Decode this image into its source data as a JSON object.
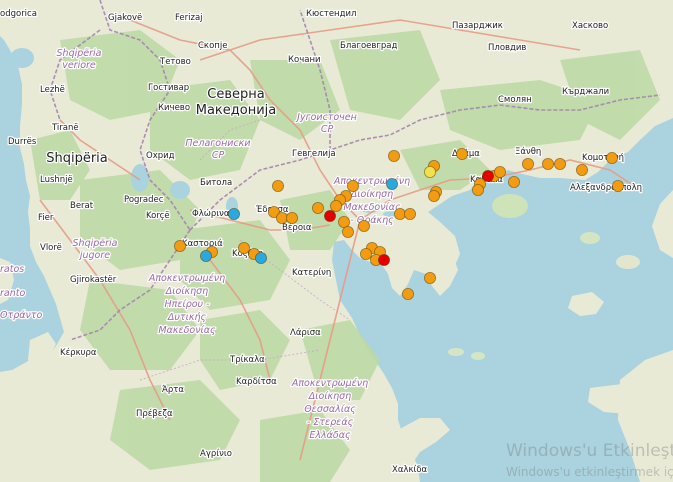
{
  "colors": {
    "land": "#e6e8d3",
    "forest": "#b9d5a1",
    "sea": "#aad3df",
    "border": "#9f7fa8",
    "road": "#e79b85",
    "marker_orange": "#f39c12",
    "marker_red": "#e50000",
    "marker_blue": "#29a9e0",
    "marker_yellow": "#f4e04d"
  },
  "labels": {
    "country_macedonia": "Северна Македонија",
    "country_albania": "Shqipëria",
    "region_pelagonia": "Пелагониски СР",
    "region_yugoistochen": "Југоисточен СР",
    "region_shqiperia_veriore": "Shqipëria veriore",
    "region_shqiperia_jugore": "Shqipëria jugore",
    "region_anatolikis_makedonias": "Αποκεντρωμένη Διοίκηση Μακεδονίας - Θράκης",
    "region_ipeirou": "Αποκεντρωμένη Διοίκηση Ηπείρου - Δυτικής Μακεδονίας",
    "region_thessalias": "Αποκεντρωμένη Διοίκηση Θεσσαλίας - Στερεάς Ελλάδας",
    "region_left_fragment": "ratos / ranto / Οτράντο"
  },
  "cities": [
    {
      "name": "odgorica"
    },
    {
      "name": "Gjakovë"
    },
    {
      "name": "Ferizaj"
    },
    {
      "name": "Кюстендил"
    },
    {
      "name": "Пазарджик"
    },
    {
      "name": "Хасково"
    },
    {
      "name": "Пловдив"
    },
    {
      "name": "Скопје"
    },
    {
      "name": "Тетово"
    },
    {
      "name": "Кочани"
    },
    {
      "name": "Благоевград"
    },
    {
      "name": "Смолян"
    },
    {
      "name": "Кърджали"
    },
    {
      "name": "Гостивар"
    },
    {
      "name": "Кичево"
    },
    {
      "name": "Lezhë"
    },
    {
      "name": "Tiranë"
    },
    {
      "name": "Durrës"
    },
    {
      "name": "Охрид"
    },
    {
      "name": "Гевгелија"
    },
    {
      "name": "Δράμα"
    },
    {
      "name": "Ξάνθη"
    },
    {
      "name": "Κομοτηνή"
    },
    {
      "name": "Lushnjë"
    },
    {
      "name": "Битола"
    },
    {
      "name": "Berat"
    },
    {
      "name": "Pogradec"
    },
    {
      "name": "Fier"
    },
    {
      "name": "Korçë"
    },
    {
      "name": "Φλώρινα"
    },
    {
      "name": "Έδεσσα"
    },
    {
      "name": "Καβάλα"
    },
    {
      "name": "Αλεξανδρούπολη"
    },
    {
      "name": "Vlorë"
    },
    {
      "name": "Βέροια"
    },
    {
      "name": "Καστοριά"
    },
    {
      "name": "Κοζάνη"
    },
    {
      "name": "Κατερίνη"
    },
    {
      "name": "Gjirokastër"
    },
    {
      "name": "Λάρισα"
    },
    {
      "name": "Κέρκυρα"
    },
    {
      "name": "Τρίκαλα"
    },
    {
      "name": "Άρτα"
    },
    {
      "name": "Καρδίτσα"
    },
    {
      "name": "Πρέβεζα"
    },
    {
      "name": "Αγρίνιο"
    },
    {
      "name": "Χαλκίδα"
    }
  ],
  "watermark": {
    "line1": "Windows'u Etkinleştir",
    "line2": "Windows'u etkinleştirmek için Ayarlar'a gidin."
  }
}
